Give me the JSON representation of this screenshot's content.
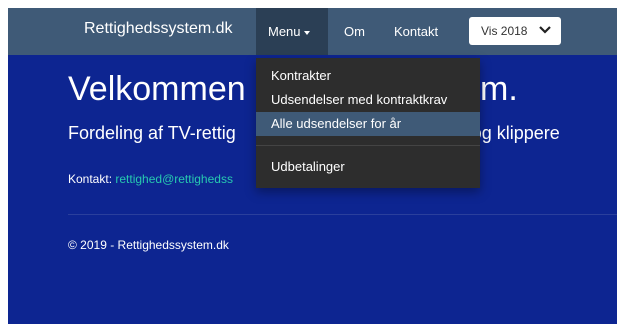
{
  "navbar": {
    "brand": "Rettighedssystem.dk",
    "menu_label": "Menu",
    "om_label": "Om",
    "kontakt_label": "Kontakt",
    "year_select": {
      "value": "Vis 2018"
    }
  },
  "dropdown": {
    "items": [
      "Kontrakter",
      "Udsendelser med kontraktkrav",
      "Alle udsendelser for år",
      "Udbetalinger"
    ]
  },
  "main": {
    "title_start": "Velkommen",
    "title_end": "system.",
    "subtitle_start": "Fordeling af TV-rettig",
    "subtitle_end": "r og klippere",
    "contact_label": "Kontakt:",
    "contact_email": "rettighed@rettighedss"
  },
  "footer": {
    "copyright": "© 2019 - Rettighedssystem.dk"
  },
  "colors": {
    "page_bg": "#0d2591",
    "navbar_bg": "#3f5a77",
    "dropdown_bg": "#2d2d2d",
    "link": "#27c9b0"
  }
}
